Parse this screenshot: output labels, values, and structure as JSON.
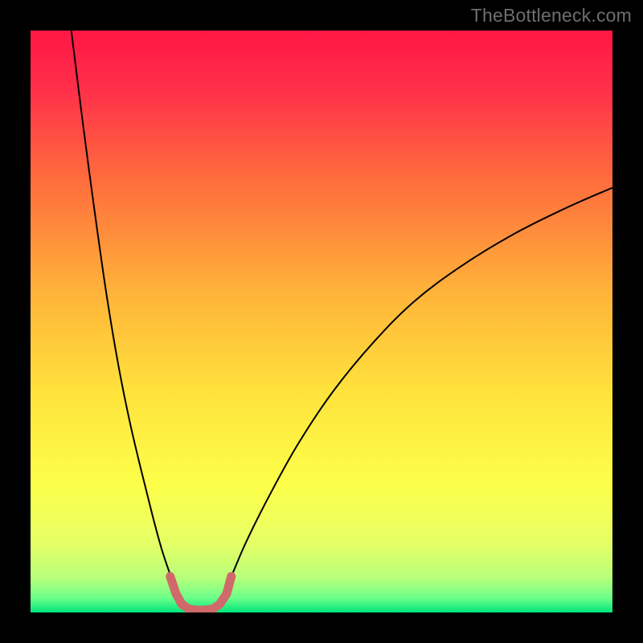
{
  "watermark": "TheBottleneck.com",
  "chart_data": {
    "type": "line",
    "title": "",
    "xlabel": "",
    "ylabel": "",
    "xlim": [
      0,
      100
    ],
    "ylim": [
      0,
      100
    ],
    "background_gradient": {
      "stops": [
        {
          "offset": 0.0,
          "color": "#ff1744"
        },
        {
          "offset": 0.1,
          "color": "#ff2f4a"
        },
        {
          "offset": 0.25,
          "color": "#ff6a3d"
        },
        {
          "offset": 0.45,
          "color": "#ffb33a"
        },
        {
          "offset": 0.62,
          "color": "#ffe23c"
        },
        {
          "offset": 0.78,
          "color": "#fdff4a"
        },
        {
          "offset": 0.88,
          "color": "#e6ff66"
        },
        {
          "offset": 0.94,
          "color": "#b9ff7a"
        },
        {
          "offset": 0.975,
          "color": "#6dff8a"
        },
        {
          "offset": 1.0,
          "color": "#00e67a"
        }
      ]
    },
    "series": [
      {
        "name": "curve-left",
        "stroke": "#000000",
        "stroke_width": 2.0,
        "x": [
          7.0,
          9.0,
          11.0,
          13.0,
          15.0,
          17.0,
          19.0,
          21.0,
          22.5,
          24.0,
          25.3,
          26.3
        ],
        "y": [
          100.0,
          84.0,
          69.0,
          55.0,
          43.0,
          33.0,
          24.5,
          16.5,
          11.0,
          6.5,
          3.0,
          0.8
        ]
      },
      {
        "name": "curve-right",
        "stroke": "#000000",
        "stroke_width": 2.0,
        "x": [
          32.0,
          34.0,
          37.0,
          41.0,
          46.0,
          52.0,
          59.0,
          66.0,
          74.0,
          83.0,
          92.0,
          100.0
        ],
        "y": [
          0.8,
          5.0,
          12.0,
          20.0,
          29.0,
          38.0,
          46.5,
          53.5,
          59.5,
          65.0,
          69.5,
          73.0
        ]
      },
      {
        "name": "valley-marker",
        "stroke": "#d06a6a",
        "stroke_width": 11,
        "linecap": "round",
        "x": [
          24.0,
          25.0,
          26.0,
          27.2,
          28.5,
          30.0,
          31.3,
          32.5,
          33.7,
          34.5
        ],
        "y": [
          6.2,
          3.2,
          1.4,
          0.6,
          0.4,
          0.4,
          0.6,
          1.4,
          3.2,
          6.2
        ]
      }
    ]
  }
}
